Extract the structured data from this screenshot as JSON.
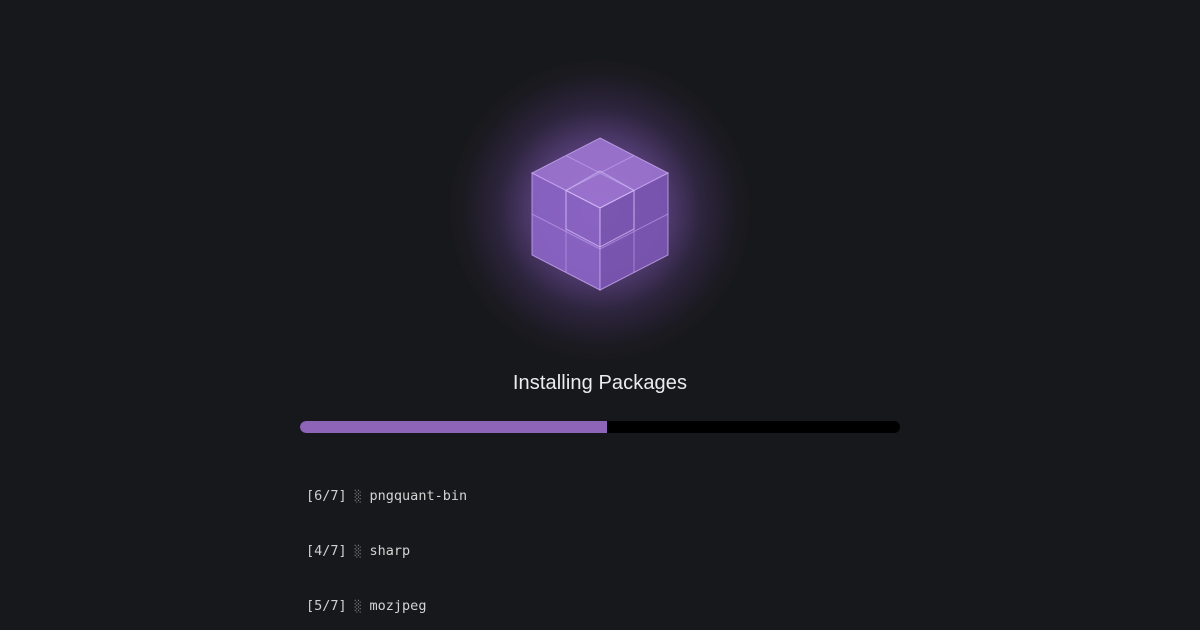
{
  "app": {
    "title": "Installing Packages",
    "logo_icon": "package-cube-icon"
  },
  "progress": {
    "fraction": 0.512,
    "fill_color": "#8e64b8",
    "track_color": "#000000"
  },
  "log": {
    "lines": [
      {
        "step": "[6/7]",
        "separator": "░",
        "package": "pngquant-bin"
      },
      {
        "step": "[4/7]",
        "separator": "░",
        "package": "sharp"
      },
      {
        "step": "[5/7]",
        "separator": "░",
        "package": "mozjpeg"
      }
    ]
  },
  "colors": {
    "background": "#17181b",
    "accent": "#8e64b8",
    "text": "#ececec"
  }
}
